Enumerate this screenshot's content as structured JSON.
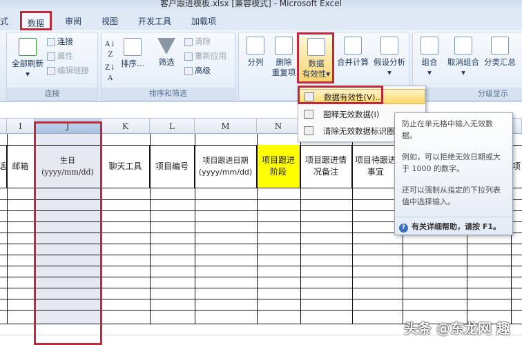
{
  "window": {
    "title": "客户跟进模板.xlsx  [兼容模式] - Microsoft Excel"
  },
  "tabs": [
    "式",
    "数据",
    "审阅",
    "视图",
    "开发工具",
    "加载项"
  ],
  "ribbon": {
    "connections": {
      "refresh_all": "全部刷新",
      "connect": "连接",
      "properties": "属性",
      "edit_links": "编辑链接",
      "label": "连接"
    },
    "sort_filter": {
      "sort": "排序...",
      "filter": "筛选",
      "clear": "清除",
      "reapply": "重新应用",
      "advanced": "高级",
      "label": "排序和筛选"
    },
    "data_tools": {
      "text_to_columns": "分列",
      "remove_dup_1": "删除",
      "remove_dup_2": "重复项",
      "validation_1": "数据",
      "validation_2": "有效性",
      "consolidate": "合并计算",
      "what_if": "假设分析"
    },
    "outline": {
      "group": "组合",
      "ungroup": "取消组合",
      "subtotal": "分类汇总",
      "label": "分级显示"
    }
  },
  "menu": {
    "items": [
      "数据有效性(V)...",
      "圈释无效数据(I)",
      "清除无效数据标识圈"
    ]
  },
  "tooltip": {
    "p1": "防止在单元格中输入无效数据。",
    "p2": "例如，可以拒绝无效日期或大于 1000 的数字。",
    "p3": "还可以强制从指定的下拉列表值中选择输入。",
    "help": "有关详细帮助，请按 F1。"
  },
  "sheet": {
    "columns": [
      "I",
      "J",
      "K",
      "L",
      "M",
      "N"
    ],
    "headers": [
      "话",
      "邮箱",
      "生日\n(yyyy/mm/dd)",
      "聊天工具",
      "项目编号",
      "项目跟进日期\n(yyyy/mm/dd)",
      "项目跟进\n阶段",
      "项目跟进情\n况备注",
      "项目待跟进\n事宜",
      "项"
    ],
    "highlight_color": "#ffff00"
  },
  "watermark": "头条 @东龙网 趣"
}
